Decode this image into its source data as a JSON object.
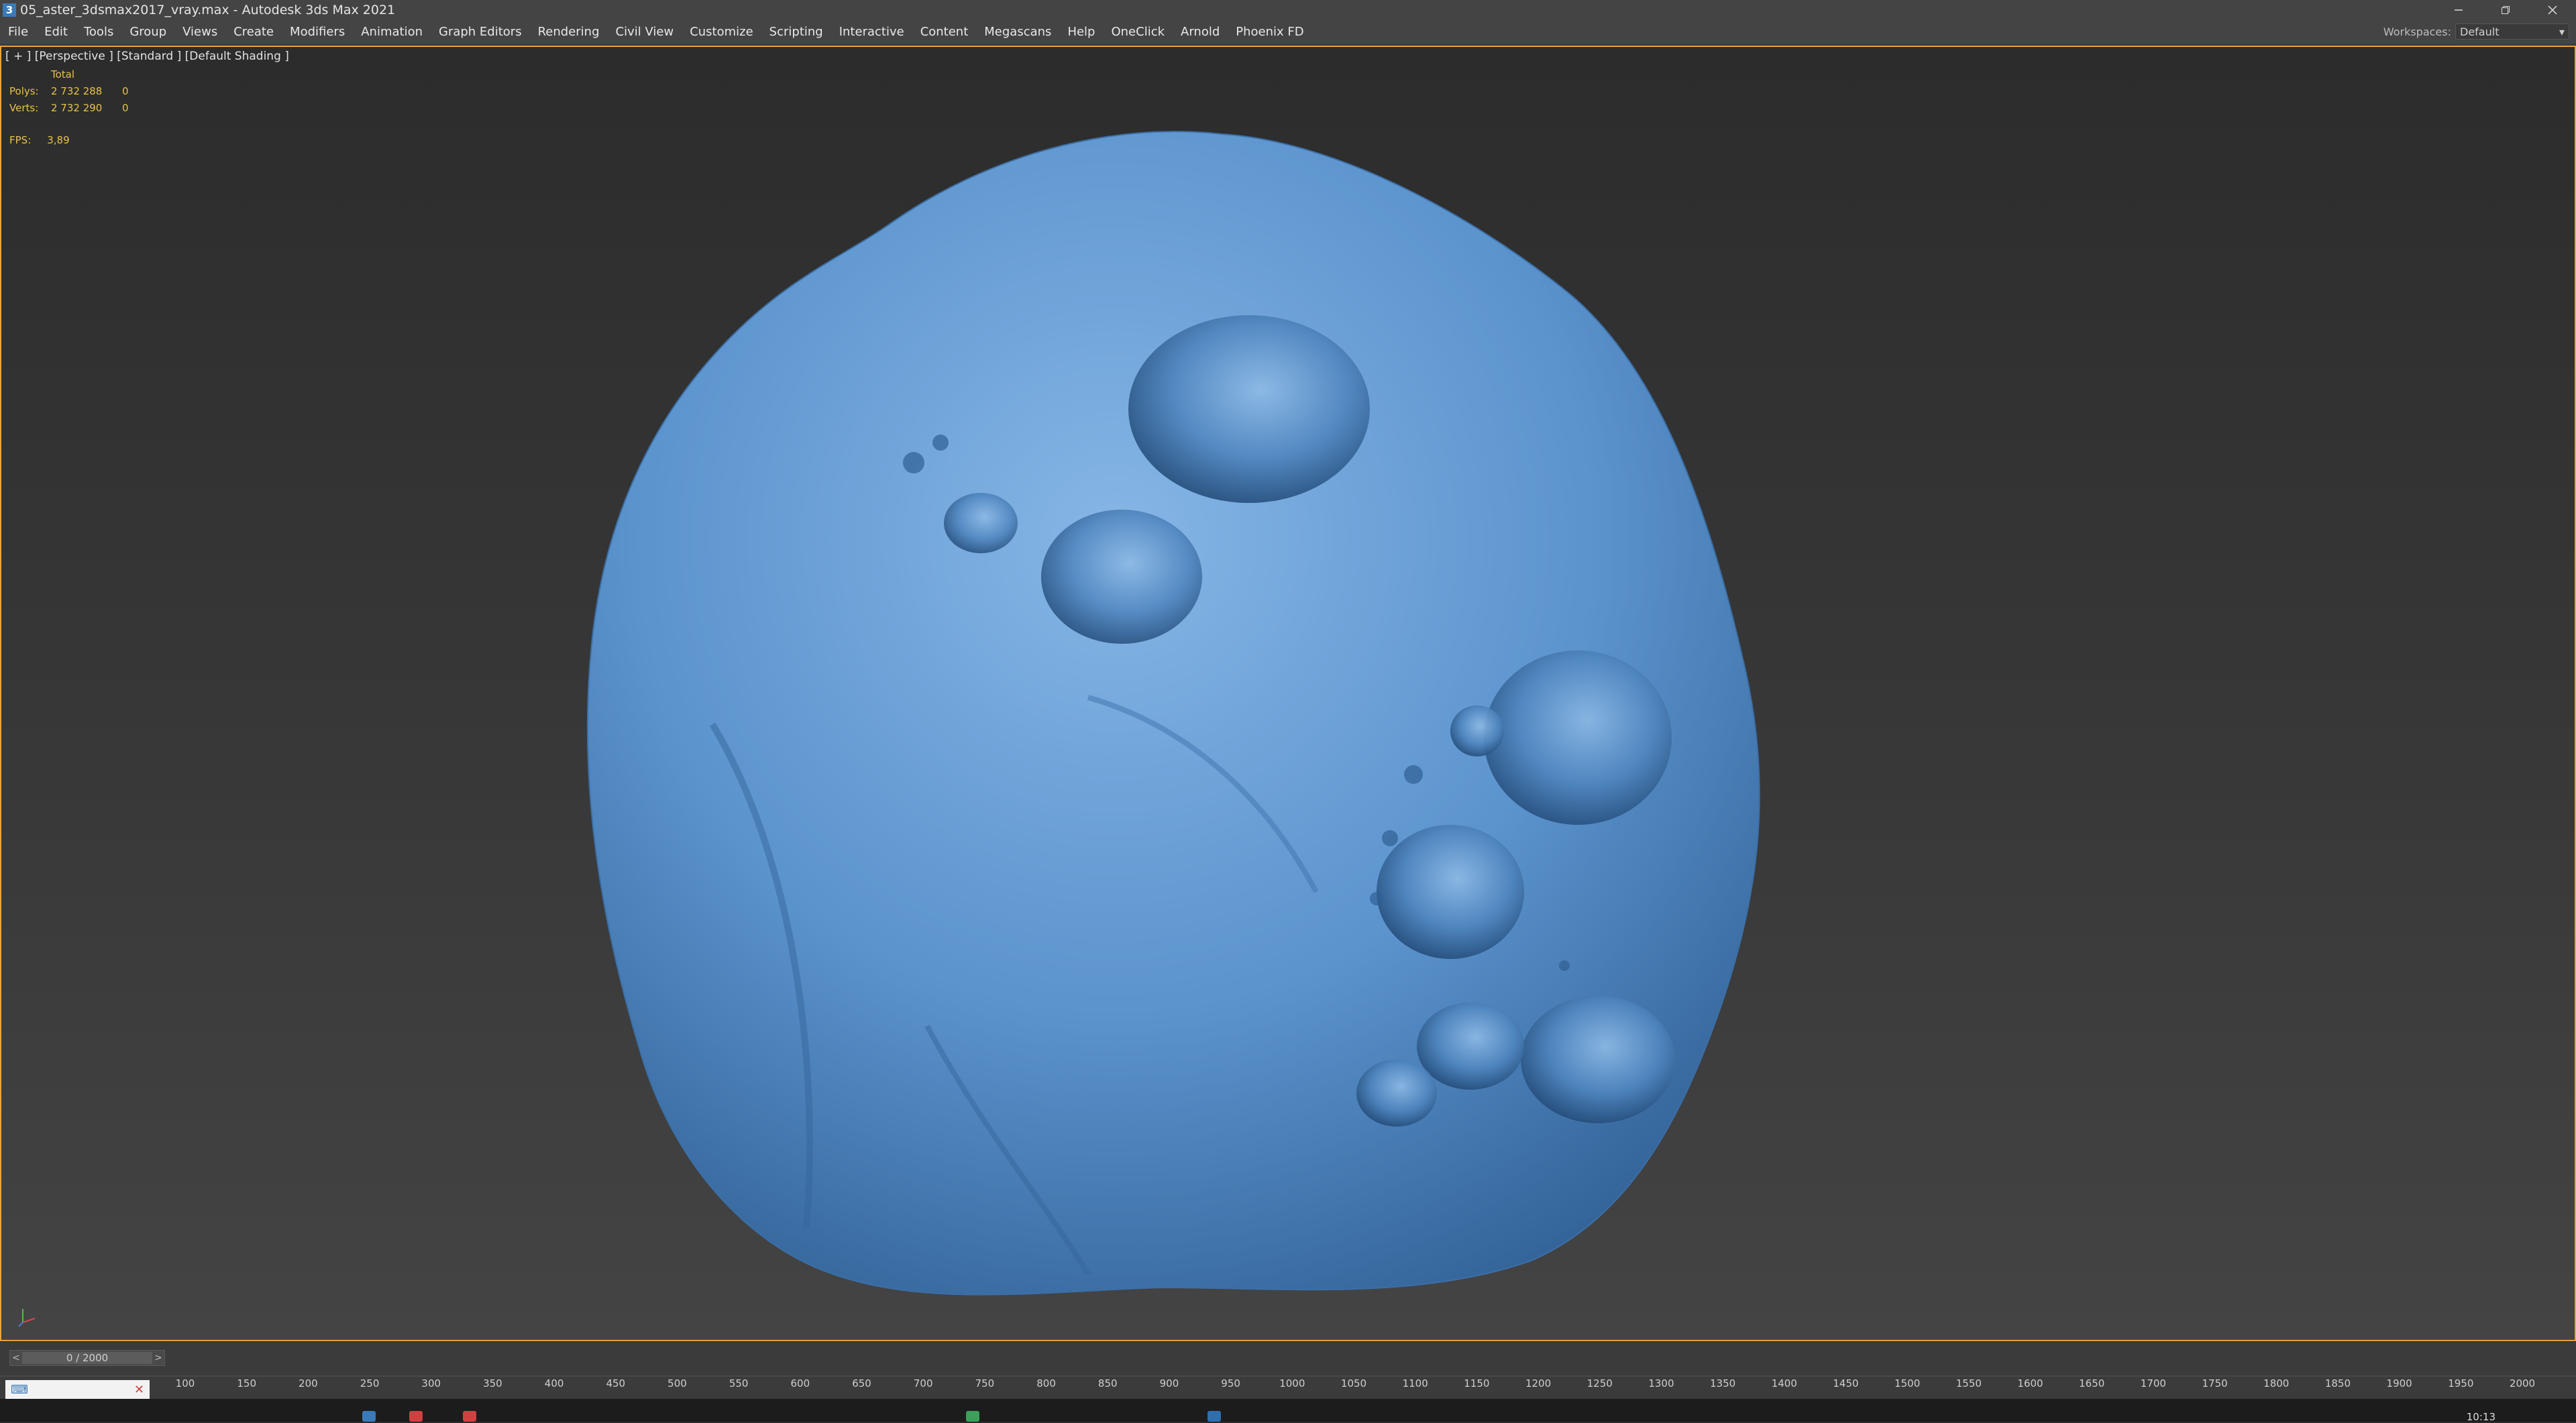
{
  "window": {
    "title": "05_aster_3dsmax2017_vray.max - Autodesk 3ds Max 2021",
    "app_icon": "3",
    "minimize_icon": "minimize-icon",
    "restore_icon": "restore-icon",
    "close_icon": "close-icon"
  },
  "menu": {
    "items": [
      "File",
      "Edit",
      "Tools",
      "Group",
      "Views",
      "Create",
      "Modifiers",
      "Animation",
      "Graph Editors",
      "Rendering",
      "Civil View",
      "Customize",
      "Scripting",
      "Interactive",
      "Content",
      "Megascans",
      "Help",
      "OneClick",
      "Arnold",
      "Phoenix FD"
    ]
  },
  "workspace": {
    "label": "Workspaces:",
    "value": "Default"
  },
  "viewport": {
    "label": "[ + ] [Perspective ] [Standard ] [Default Shading ]",
    "stats": {
      "header": "Total",
      "polys_label": "Polys:",
      "polys_total": "2 732 288",
      "polys_selected": "0",
      "verts_label": "Verts:",
      "verts_total": "2 732 290",
      "verts_selected": "0"
    },
    "fps_label": "FPS:",
    "fps_value": "3,89",
    "object_color": "#5b93cd",
    "border_color": "#e8a53a"
  },
  "timeslider": {
    "value": "0 / 2000",
    "prev": "<",
    "next": ">"
  },
  "trackbar": {
    "ticks": [
      "100",
      "150",
      "200",
      "250",
      "300",
      "350",
      "400",
      "450",
      "500",
      "550",
      "600",
      "650",
      "700",
      "750",
      "800",
      "850",
      "900",
      "950",
      "1000",
      "1050",
      "1100",
      "1150",
      "1200",
      "1250",
      "1300",
      "1350",
      "1400",
      "1450",
      "1500",
      "1550",
      "1600",
      "1650",
      "1700",
      "1750",
      "1800",
      "1850",
      "1900",
      "1950",
      "2000"
    ]
  },
  "taskbar": {
    "clock": "10:13"
  }
}
